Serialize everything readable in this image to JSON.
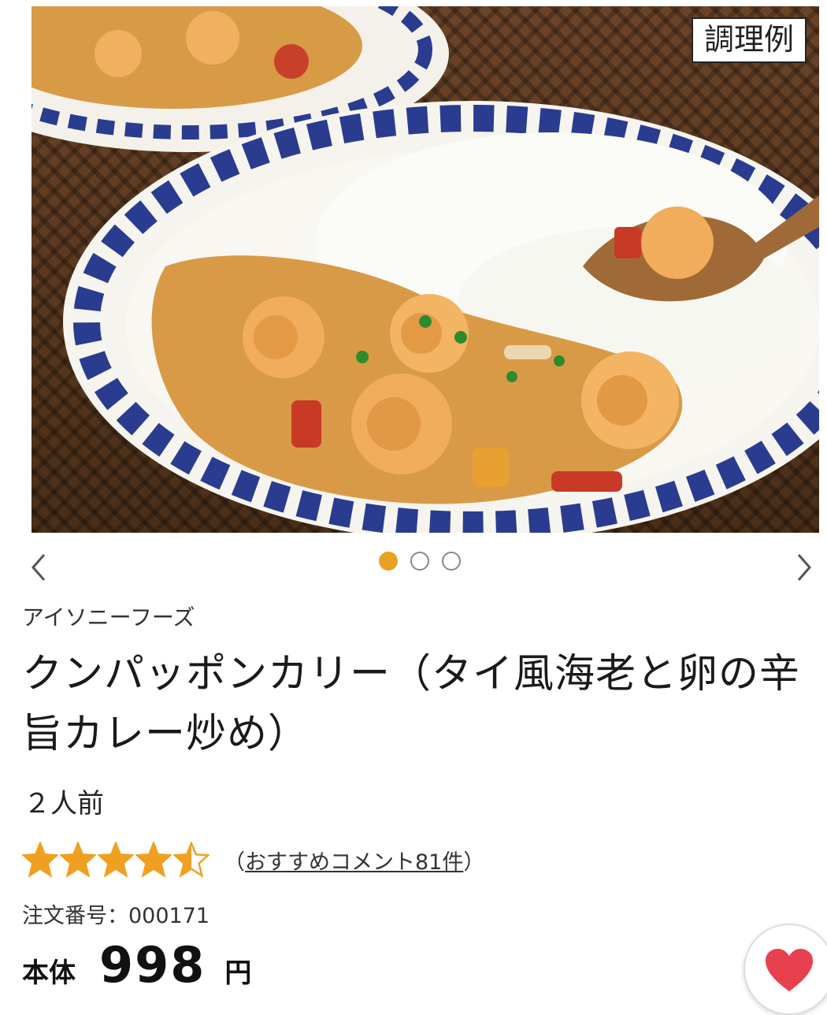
{
  "hero": {
    "badge_text": "調理例"
  },
  "carousel": {
    "slide_count": 3,
    "active_index": 0,
    "active_color": "#e8a221"
  },
  "product": {
    "maker": "アイソニーフーズ",
    "title": "クンパッポンカリー（タイ風海老と卵の辛旨カレー炒め）",
    "servings": "２人前",
    "rating": {
      "stars": 4.5,
      "max": 5,
      "star_color": "#f0a020",
      "open_paren": "（",
      "review_link": "おすすめコメント81件",
      "close_paren": "）"
    },
    "order_number": "注文番号：000171",
    "price": {
      "label": "本体",
      "value": "998",
      "unit": "円"
    }
  },
  "favorite": {
    "icon": "heart-icon",
    "color": "#e8404f"
  }
}
